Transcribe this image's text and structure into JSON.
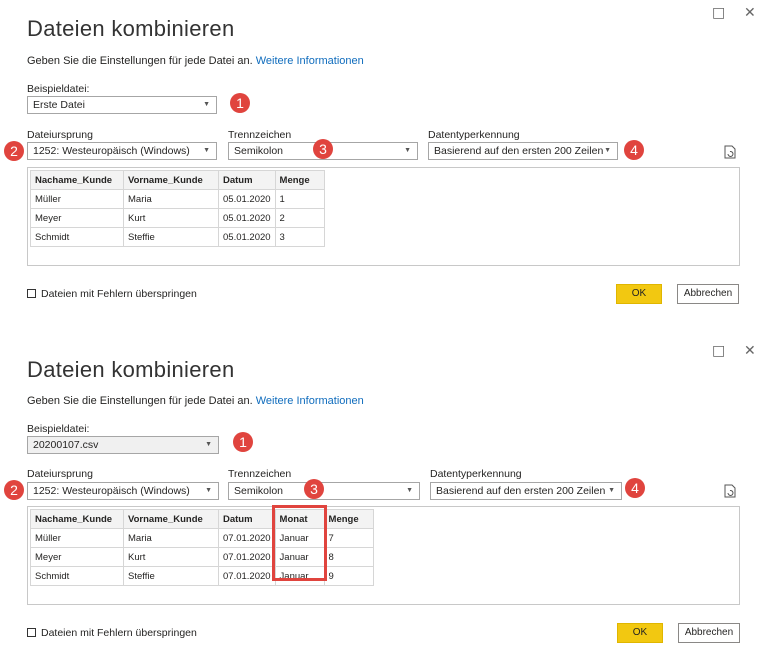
{
  "window_controls": {
    "maximize": "□",
    "close": "✕"
  },
  "dialogs": [
    {
      "title": "Dateien kombinieren",
      "subtitle": "Geben Sie die Einstellungen für jede Datei an.",
      "link": "Weitere Informationen",
      "sample_file": {
        "label": "Beispieldatei:",
        "value": "Erste Datei"
      },
      "origin": {
        "label": "Dateiursprung",
        "value": "1252: Westeuropäisch (Windows)"
      },
      "delimiter": {
        "label": "Trennzeichen",
        "value": "Semikolon"
      },
      "type_detection": {
        "label": "Datentyperkennung",
        "value": "Basierend auf den ersten 200 Zeilen"
      },
      "badges": [
        "1",
        "2",
        "3",
        "4"
      ],
      "table": {
        "headers": [
          "Nachame_Kunde",
          "Vorname_Kunde",
          "Datum",
          "Menge"
        ],
        "rows": [
          [
            "Müller",
            "Maria",
            "05.01.2020",
            "1"
          ],
          [
            "Meyer",
            "Kurt",
            "05.01.2020",
            "2"
          ],
          [
            "Schmidt",
            "Steffie",
            "05.01.2020",
            "3"
          ]
        ]
      },
      "skip_errors_label": "Dateien mit Fehlern überspringen",
      "ok_label": "OK",
      "cancel_label": "Abbrechen"
    },
    {
      "title": "Dateien kombinieren",
      "subtitle": "Geben Sie die Einstellungen für jede Datei an.",
      "link": "Weitere Informationen",
      "sample_file": {
        "label": "Beispieldatei:",
        "value": "20200107.csv"
      },
      "origin": {
        "label": "Dateiursprung",
        "value": "1252: Westeuropäisch (Windows)"
      },
      "delimiter": {
        "label": "Trennzeichen",
        "value": "Semikolon"
      },
      "type_detection": {
        "label": "Datentyperkennung",
        "value": "Basierend auf den ersten 200 Zeilen"
      },
      "badges": [
        "1",
        "2",
        "3",
        "4"
      ],
      "table": {
        "headers": [
          "Nachame_Kunde",
          "Vorname_Kunde",
          "Datum",
          "Monat",
          "Menge"
        ],
        "rows": [
          [
            "Müller",
            "Maria",
            "07.01.2020",
            "Januar",
            "7"
          ],
          [
            "Meyer",
            "Kurt",
            "07.01.2020",
            "Januar",
            "8"
          ],
          [
            "Schmidt",
            "Steffie",
            "07.01.2020",
            "Januar",
            "9"
          ]
        ]
      },
      "skip_errors_label": "Dateien mit Fehlern überspringen",
      "ok_label": "OK",
      "cancel_label": "Abbrechen"
    }
  ],
  "colors": {
    "accent_ok": "#f2c811",
    "badge": "#e0443e",
    "link": "#0f6cbd"
  }
}
